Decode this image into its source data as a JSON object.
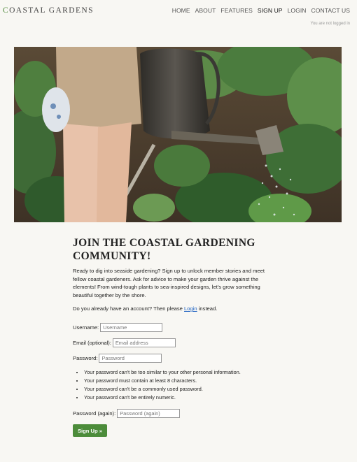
{
  "brand": {
    "logo_first": "C",
    "logo_rest": "OASTAL GARDENS"
  },
  "nav": {
    "items": [
      "HOME",
      "ABOUT",
      "FEATURES",
      "SIGN UP",
      "LOGIN",
      "CONTACT US"
    ],
    "active": "SIGN UP"
  },
  "status": {
    "login_state": "You are not logged in"
  },
  "hero": {
    "icon": "garden-photo"
  },
  "main": {
    "title": "JOIN THE COASTAL GARDENING COMMUNITY!",
    "intro": "Ready to dig into seaside gardening? Sign up to unlock member stories and meet fellow coastal gardeners. Ask for advice to make your garden thrive against the elements! From wind-tough plants to sea-inspired designs, let's grow something beautiful together by the shore.",
    "account_prefix": "Do you already have an account? Then please ",
    "account_link": "Login",
    "account_suffix": " instead."
  },
  "form": {
    "username_label": "Username:",
    "username_placeholder": "Username",
    "email_label": "Email (optional):",
    "email_placeholder": "Email address",
    "password_label": "Password:",
    "password_placeholder": "Password",
    "password_help": [
      "Your password can't be too similar to your other personal information.",
      "Your password must contain at least 8 characters.",
      "Your password can't be a commonly used password.",
      "Your password can't be entirely numeric."
    ],
    "password2_label": "Password (again):",
    "password2_placeholder": "Password (again)",
    "submit_label": "Sign Up »"
  },
  "colors": {
    "accent": "#4c8c3a",
    "link": "#1a5fc0",
    "background": "#f8f7f3"
  }
}
